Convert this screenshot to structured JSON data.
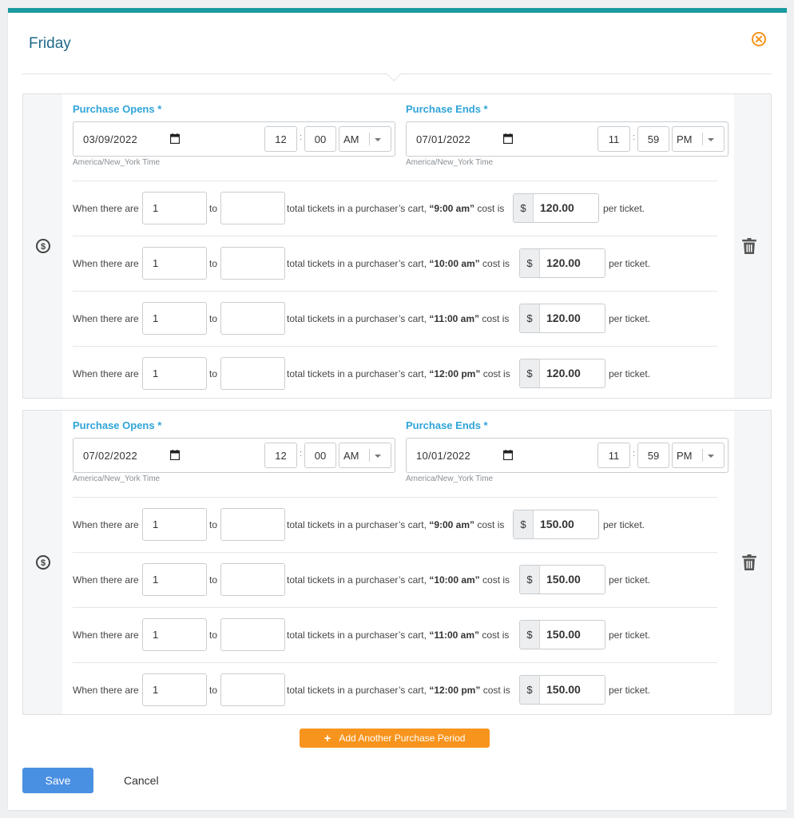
{
  "header": {
    "title": "Friday"
  },
  "periods": [
    {
      "opens": {
        "label": "Purchase Opens *",
        "date": "03/09/2022",
        "hour": "12",
        "minute": "00",
        "ampm": "AM",
        "tz": "America/New_York Time"
      },
      "ends": {
        "label": "Purchase Ends *",
        "date": "07/01/2022",
        "hour": "11",
        "minute": "59",
        "ampm": "PM",
        "tz": "America/New_York Time"
      },
      "rules": [
        {
          "from": "1",
          "to": "",
          "time": "“9:00 am”",
          "price": "120.00"
        },
        {
          "from": "1",
          "to": "",
          "time": "“10:00 am”",
          "price": "120.00"
        },
        {
          "from": "1",
          "to": "",
          "time": "“11:00 am”",
          "price": "120.00"
        },
        {
          "from": "1",
          "to": "",
          "time": "“12:00 pm”",
          "price": "120.00"
        }
      ]
    },
    {
      "opens": {
        "label": "Purchase Opens *",
        "date": "07/02/2022",
        "hour": "12",
        "minute": "00",
        "ampm": "AM",
        "tz": "America/New_York Time"
      },
      "ends": {
        "label": "Purchase Ends *",
        "date": "10/01/2022",
        "hour": "11",
        "minute": "59",
        "ampm": "PM",
        "tz": "America/New_York Time"
      },
      "rules": [
        {
          "from": "1",
          "to": "",
          "time": "“9:00 am”",
          "price": "150.00"
        },
        {
          "from": "1",
          "to": "",
          "time": "“10:00 am”",
          "price": "150.00"
        },
        {
          "from": "1",
          "to": "",
          "time": "“11:00 am”",
          "price": "150.00"
        },
        {
          "from": "1",
          "to": "",
          "time": "“12:00 pm”",
          "price": "150.00"
        }
      ]
    }
  ],
  "rule_text": {
    "when": "When there are",
    "to": "to",
    "mid": "total tickets in a purchaser’s cart,",
    "cost": "cost is",
    "currency": "$",
    "per": "per ticket."
  },
  "actions": {
    "add_period": "Add Another Purchase Period",
    "save": "Save",
    "cancel": "Cancel"
  },
  "colors": {
    "accent_teal": "#1a9aa0",
    "title_blue": "#1f6a8a",
    "label_blue": "#2fa4d9",
    "orange": "#f7941d",
    "save_blue": "#4a90e2"
  },
  "icons": {
    "close": "close-circle-icon",
    "dollar": "dollar-circle-icon",
    "trash": "trash-icon",
    "calendar": "calendar-icon",
    "plus": "plus-icon"
  }
}
